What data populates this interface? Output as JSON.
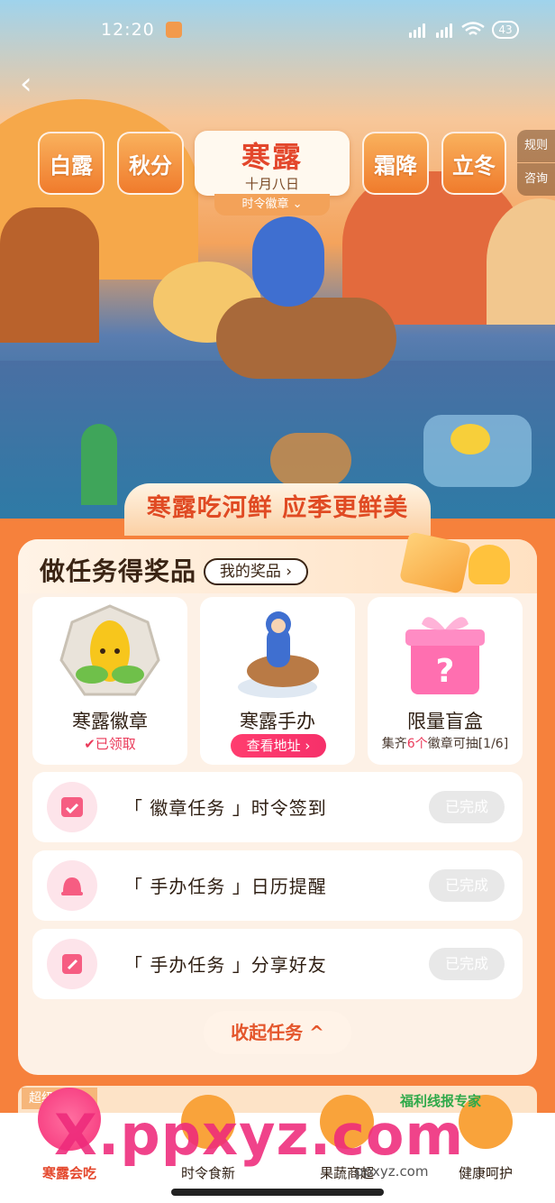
{
  "status_bar": {
    "time": "12:20",
    "battery": "43"
  },
  "top_buttons": {
    "rules": "规则",
    "consult": "咨询"
  },
  "solar_terms": {
    "tabs": [
      "白露",
      "秋分",
      "霜降",
      "立冬"
    ],
    "active": {
      "name": "寒露",
      "date": "十月八日",
      "badge_tag": "时令徽章"
    }
  },
  "slogan": "寒露吃河鲜 应季更鲜美",
  "tasks_panel": {
    "title": "做任务得奖品",
    "my_prizes": "我的奖品",
    "prizes": [
      {
        "name": "寒露徽章",
        "status": "已领取"
      },
      {
        "name": "寒露手办",
        "action": "查看地址"
      },
      {
        "name": "限量盲盒",
        "desc_prefix": "集齐",
        "desc_count": "6个",
        "desc_suffix": "徽章可抽[1/6]"
      }
    ],
    "tasks": [
      {
        "label": "「 徽章任务 」时令签到",
        "button": "已完成",
        "icon": "calendar-check-icon"
      },
      {
        "label": "「 手办任务 」日历提醒",
        "button": "已完成",
        "icon": "bell-icon"
      },
      {
        "label": "「 手办任务 」分享好友",
        "button": "已完成",
        "icon": "share-icon"
      }
    ],
    "collapse_label": "收起任务"
  },
  "bottom_strip": {
    "tag": "超级"
  },
  "bottom_nav": [
    {
      "label": "寒露会吃",
      "active": true
    },
    {
      "label": "时令食新"
    },
    {
      "label": "果蔬商超"
    },
    {
      "label": "健康呵护"
    }
  ],
  "watermark": {
    "main": "X.ppxyz.com",
    "logo": "福利线报专家",
    "url": "ppxyz.com"
  },
  "colors": {
    "primary_orange": "#f6813c",
    "red": "#e3472c",
    "pink": "#f6306a"
  }
}
